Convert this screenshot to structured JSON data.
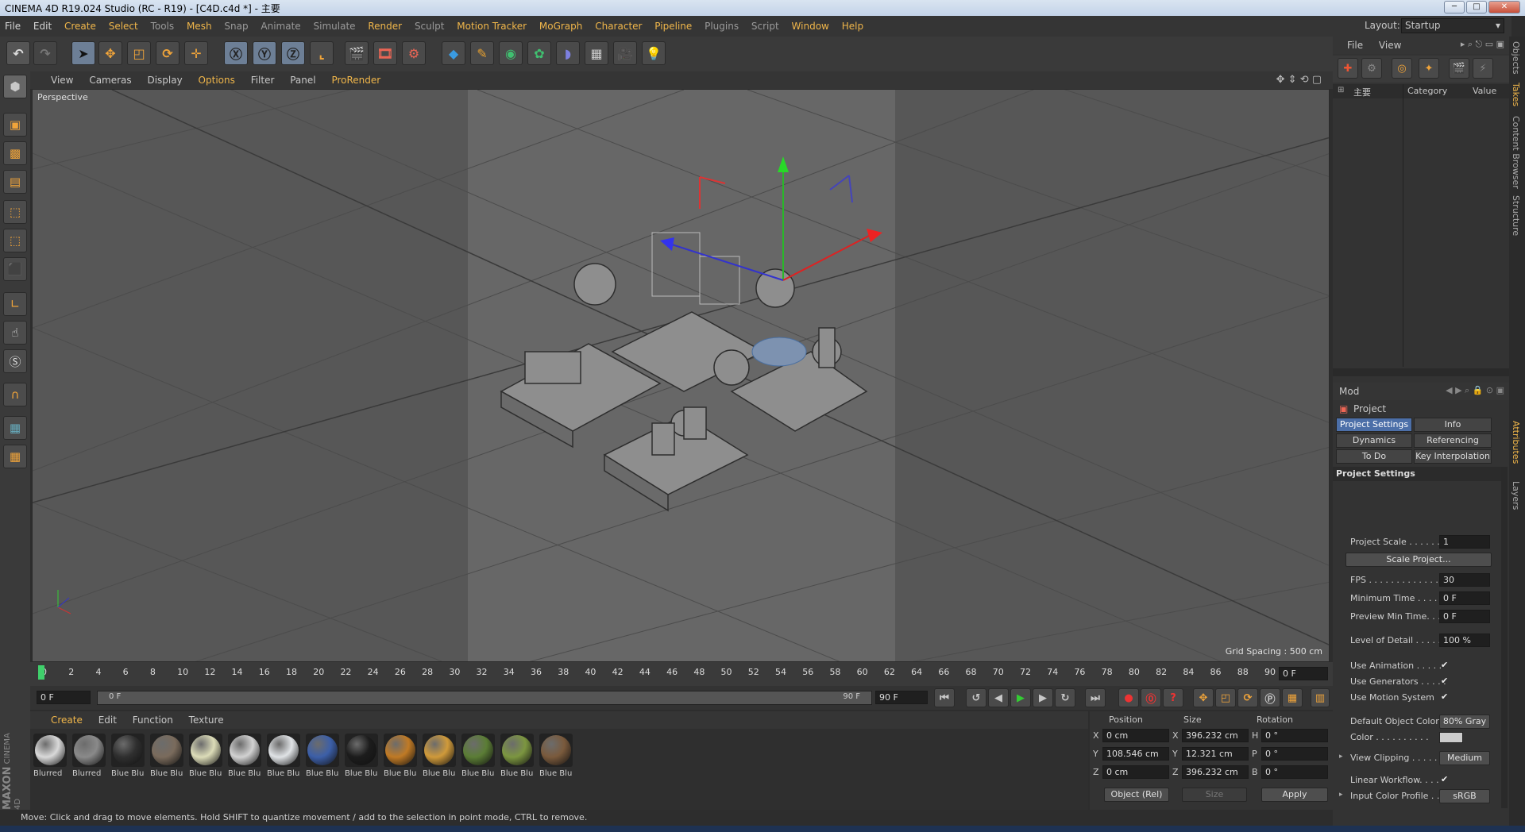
{
  "window": {
    "title": "CINEMA 4D R19.024 Studio (RC - R19) - [C4D.c4d *] - 主要",
    "min": "─",
    "max": "□",
    "close": "✕"
  },
  "menubar": {
    "items": [
      "File",
      "Edit",
      "Create",
      "Select",
      "Tools",
      "Mesh",
      "Snap",
      "Animate",
      "Simulate",
      "Render",
      "Sculpt",
      "Motion Tracker",
      "MoGraph",
      "Character",
      "Pipeline",
      "Plugins",
      "Script",
      "Window",
      "Help"
    ],
    "layout_label": "Layout:",
    "layout_value": "Startup"
  },
  "viewport_menu": {
    "items": [
      "View",
      "Cameras",
      "Display",
      "Options",
      "Filter",
      "Panel",
      "ProRender"
    ]
  },
  "viewport": {
    "label": "Perspective",
    "grid_spacing": "Grid Spacing : 500 cm"
  },
  "timeline": {
    "ticks": [
      "0",
      "2",
      "4",
      "6",
      "8",
      "10",
      "12",
      "14",
      "16",
      "18",
      "20",
      "22",
      "24",
      "26",
      "28",
      "30",
      "32",
      "34",
      "36",
      "38",
      "40",
      "42",
      "44",
      "46",
      "48",
      "50",
      "52",
      "54",
      "56",
      "58",
      "60",
      "62",
      "64",
      "66",
      "68",
      "70",
      "72",
      "74",
      "76",
      "78",
      "80",
      "82",
      "84",
      "86",
      "88",
      "90"
    ],
    "current_frame": "0 F"
  },
  "range": {
    "start": "0 F",
    "slider_start": "0 F",
    "slider_end": "90 F",
    "end": "90 F"
  },
  "materials": {
    "menu": [
      "Create",
      "Edit",
      "Function",
      "Texture"
    ],
    "items": [
      {
        "name": "Blurred",
        "color": "#d9d9d9"
      },
      {
        "name": "Blurred",
        "color": "#8a8a8a"
      },
      {
        "name": "Blue Blu",
        "color": "#2f2f2f"
      },
      {
        "name": "Blue Blu",
        "color": "#7a6b5c"
      },
      {
        "name": "Blue Blu",
        "color": "#dcdcb8"
      },
      {
        "name": "Blue Blu",
        "color": "#d2d2d2"
      },
      {
        "name": "Blue Blu",
        "color": "#e0e3e6"
      },
      {
        "name": "Blue Blu",
        "color": "#3c5fa8"
      },
      {
        "name": "Blue Blu",
        "color": "#1c1c1c"
      },
      {
        "name": "Blue Blu",
        "color": "#c07a25"
      },
      {
        "name": "Blue Blu",
        "color": "#d09a3a"
      },
      {
        "name": "Blue Blu",
        "color": "#5b7d35"
      },
      {
        "name": "Blue Blu",
        "color": "#7c9640"
      },
      {
        "name": "Blue Blu",
        "color": "#7a5a3c"
      }
    ]
  },
  "coords": {
    "headers": [
      "Position",
      "Size",
      "Rotation"
    ],
    "rows": [
      {
        "axis": "X",
        "pos": "0 cm",
        "saxis": "X",
        "size": "396.232 cm",
        "raxis": "H",
        "rot": "0 °"
      },
      {
        "axis": "Y",
        "pos": "108.546 cm",
        "saxis": "Y",
        "size": "12.321 cm",
        "raxis": "P",
        "rot": "0 °"
      },
      {
        "axis": "Z",
        "pos": "0 cm",
        "saxis": "Z",
        "size": "396.232 cm",
        "raxis": "B",
        "rot": "0 °"
      }
    ],
    "mode": "Object (Rel)",
    "size_mode": "Size",
    "apply": "Apply"
  },
  "status": "Move: Click and drag to move elements. Hold SHIFT to quantize movement / add to the selection in point mode, CTRL to remove.",
  "objects_panel": {
    "menu": [
      "File",
      "View"
    ],
    "item": "主要",
    "columns": [
      "Category",
      "Value"
    ]
  },
  "attributes": {
    "mode": "Mod",
    "object": "Project",
    "tabs": [
      "Project Settings",
      "Info",
      "Dynamics",
      "Referencing",
      "To Do",
      "Key Interpolation"
    ],
    "section": "Project Settings",
    "fields": [
      {
        "label": "Project Scale . . . . . .",
        "value": "1"
      },
      {
        "label": "FPS . . . . . . . . . . . . . .",
        "value": "30"
      },
      {
        "label": "Minimum Time . . . . .",
        "value": "0 F"
      },
      {
        "label": "Preview Min Time. . . .",
        "value": "0 F"
      },
      {
        "label": "Level of Detail . . . . .",
        "value": "100 %"
      }
    ],
    "scale_button": "Scale Project...",
    "checks": [
      "Use Animation . . . . .",
      "Use Generators . . . . .",
      "Use Motion System"
    ],
    "default_color_label": "Default Object Color",
    "default_color_value": "80% Gray",
    "color_label": "Color . . . . . . . . . .",
    "view_clipping_label": "View Clipping . . . . .",
    "view_clipping_value": "Medium",
    "linear_workflow": "Linear Workflow. . . .",
    "input_profile_label": "Input Color Profile . .",
    "input_profile_value": "sRGB"
  },
  "side_tabs": [
    "Objects",
    "Takes",
    "Content Browser",
    "Structure",
    "Attributes",
    "Layers"
  ],
  "logo": {
    "brand": "MAXON",
    "product": "CINEMA 4D"
  },
  "icons": [
    "undo-icon",
    "redo-icon",
    "select-icon",
    "move-icon",
    "scale-icon",
    "rotate-icon",
    "x-axis-icon",
    "y-axis-icon",
    "z-axis-icon",
    "coordinate-icon",
    "render-view-icon",
    "render-picture-icon",
    "render-settings-icon",
    "cube-icon",
    "pen-icon",
    "subdivision-icon",
    "cloner-icon",
    "deformer-icon",
    "floor-icon",
    "camera-icon",
    "light-icon"
  ]
}
